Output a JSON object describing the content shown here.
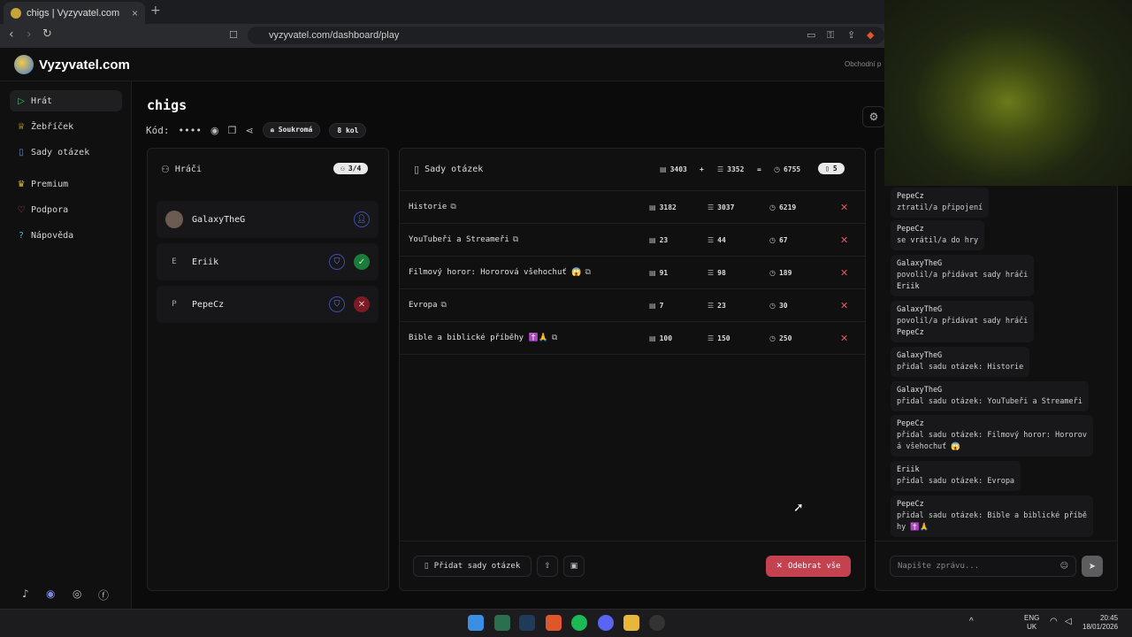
{
  "browser": {
    "tab_title": "chigs | Vyzyvatel.com",
    "tab_close": "×",
    "new_tab": "+",
    "url": "vyzyvatel.com/dashboard/play"
  },
  "app": {
    "logo_text": "Vyzyvatel.com",
    "header_right": "Obchodní p"
  },
  "sidebar": {
    "items": [
      {
        "label": "Hrát",
        "icon": "play-icon"
      },
      {
        "label": "Žebříček",
        "icon": "trophy-icon"
      },
      {
        "label": "Sady otázek",
        "icon": "book-icon"
      },
      {
        "label": "Premium",
        "icon": "crown-icon"
      },
      {
        "label": "Podpora",
        "icon": "heart-icon"
      },
      {
        "label": "Nápověda",
        "icon": "help-icon"
      }
    ],
    "social": [
      "tiktok-icon",
      "discord-icon",
      "instagram-icon",
      "facebook-icon"
    ]
  },
  "game": {
    "title": "chigs",
    "code_label": "Kód:",
    "code_value": "••••",
    "privacy": "Soukromá",
    "rounds": "8 kol"
  },
  "players_panel": {
    "title": "Hráči",
    "count": "3/4",
    "players": [
      {
        "name": "GalaxyTheG",
        "letter": ""
      },
      {
        "name": "Eriik",
        "letter": "E"
      },
      {
        "name": "PepeCz",
        "letter": "P"
      }
    ]
  },
  "sets_panel": {
    "title": "Sady otázek",
    "total_a": "3403",
    "plus": "+",
    "total_b": "3352",
    "equals": "=",
    "total_sum": "6755",
    "set_count": "5",
    "sets": [
      {
        "name": "Historie",
        "a": "3182",
        "b": "3037",
        "c": "6219"
      },
      {
        "name": "YouTubeři a Streameři",
        "a": "23",
        "b": "44",
        "c": "67"
      },
      {
        "name": "Filmový horor: Hororová všehochuť 😱",
        "a": "91",
        "b": "98",
        "c": "189"
      },
      {
        "name": "Evropa",
        "a": "7",
        "b": "23",
        "c": "30"
      },
      {
        "name": "Bible a biblické příběhy ✝️🙏",
        "a": "100",
        "b": "150",
        "c": "250"
      }
    ],
    "add_button": "Přidat sady otázek",
    "remove_all": "Odebrat vše"
  },
  "chat": {
    "messages": [
      {
        "who": "PepeCz",
        "text": "ztratil/a připojení",
        "extra": ""
      },
      {
        "who": "PepeCz",
        "text": "se vrátil/a do hry",
        "extra": ""
      },
      {
        "who": "GalaxyTheG",
        "text": "povolil/a přidávat sady hráči",
        "extra": "Eriik"
      },
      {
        "who": "GalaxyTheG",
        "text": "povolil/a přidávat sady hráči",
        "extra": "PepeCz"
      },
      {
        "who": "GalaxyTheG",
        "text": "přidal sadu otázek: Historie",
        "extra": ""
      },
      {
        "who": "GalaxyTheG",
        "text": "přidal sadu otázek: YouTubeři a Streameři",
        "extra": ""
      },
      {
        "who": "PepeCz",
        "text": "přidal sadu otázek: Filmový horor: Hororov",
        "extra": "á všehochuť 😱"
      },
      {
        "who": "Eriik",
        "text": "přidal sadu otázek: Evropa",
        "extra": ""
      },
      {
        "who": "PepeCz",
        "text": "přidal sadu otázek: Bible a biblické příbě",
        "extra": "hy ✝️🙏"
      }
    ],
    "input_placeholder": "Napište zprávu..."
  },
  "taskbar": {
    "lang_top": "ENG",
    "lang_bottom": "UK",
    "time": "20:45",
    "date": "18/01/2026"
  }
}
